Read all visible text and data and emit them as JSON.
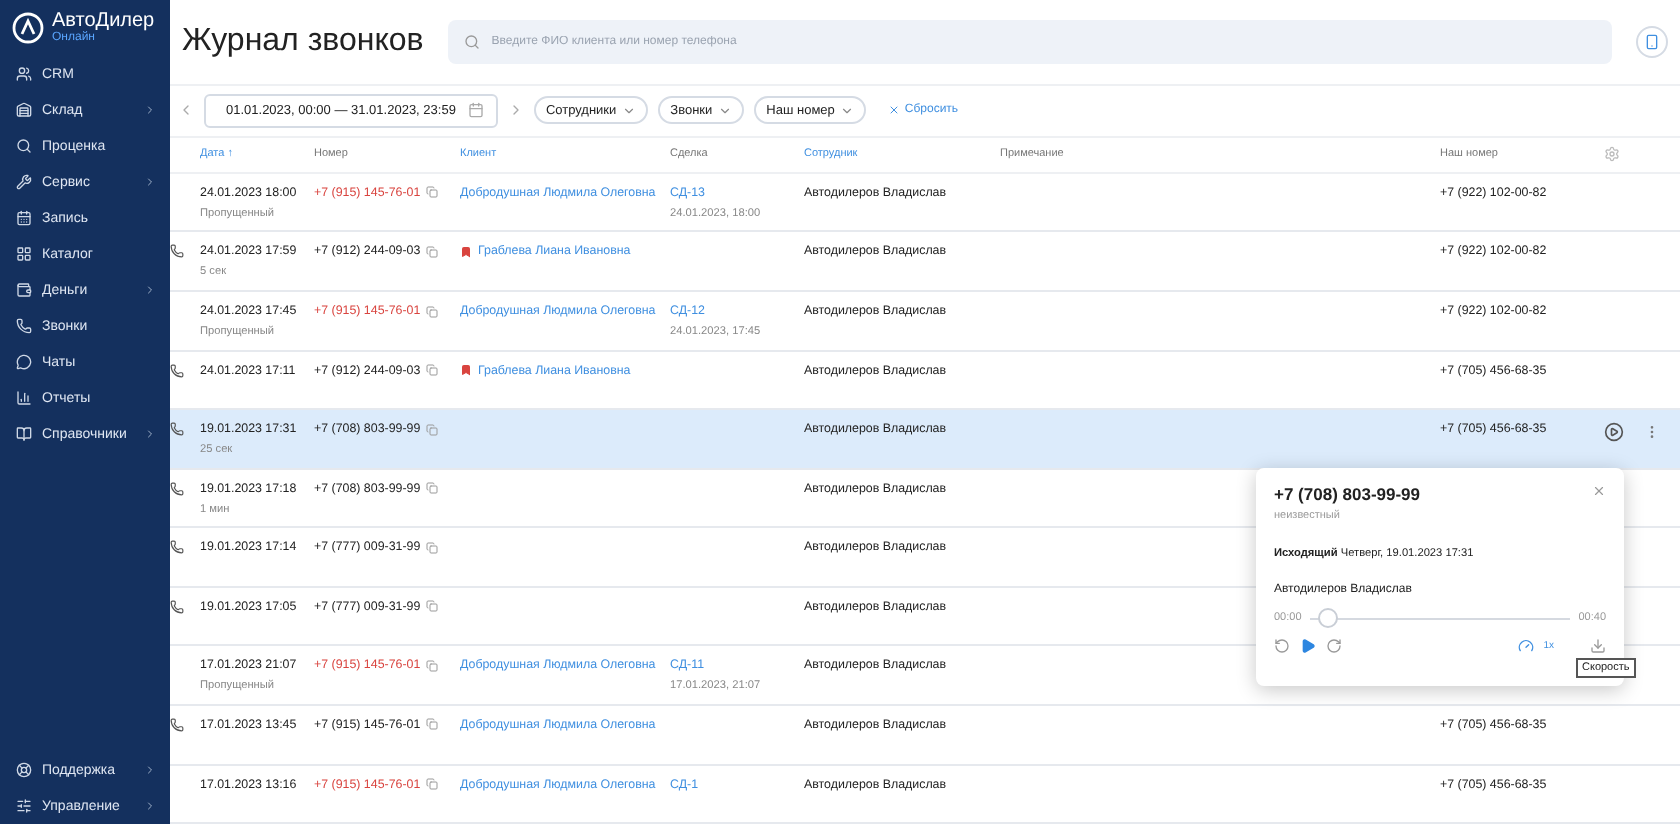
{
  "logo": {
    "name": "АвтоДилер",
    "tagline": "Онлайн"
  },
  "sidebar": {
    "items": [
      {
        "label": "CRM",
        "has_submenu": false
      },
      {
        "label": "Склад",
        "has_submenu": true
      },
      {
        "label": "Проценка",
        "has_submenu": false
      },
      {
        "label": "Сервис",
        "has_submenu": true
      },
      {
        "label": "Запись",
        "has_submenu": false
      },
      {
        "label": "Каталог",
        "has_submenu": false
      },
      {
        "label": "Деньги",
        "has_submenu": true
      },
      {
        "label": "Звонки",
        "has_submenu": false
      },
      {
        "label": "Чаты",
        "has_submenu": false
      },
      {
        "label": "Отчеты",
        "has_submenu": false
      },
      {
        "label": "Справочники",
        "has_submenu": true
      }
    ],
    "bottom_items": [
      {
        "label": "Поддержка",
        "has_submenu": true
      },
      {
        "label": "Управление",
        "has_submenu": true
      }
    ]
  },
  "title": "Журнал звонков",
  "search": {
    "placeholder": "Введите ФИО клиента или номер телефона"
  },
  "filters": {
    "date_range": "01.01.2023, 00:00 — 31.01.2023, 23:59",
    "chips": [
      "Сотрудники",
      "Звонки",
      "Наш номер"
    ],
    "reset": "Сбросить"
  },
  "table": {
    "columns": [
      "Дата ↑",
      "Номер",
      "Клиент",
      "Сделка",
      "Сотрудник",
      "Примечание",
      "Наш номер"
    ],
    "rows": [
      {
        "selected": false,
        "outgoing": false,
        "date": "24.01.2023 18:00",
        "sub": "Пропущенный",
        "phone": "+7 (915) 145-76-01",
        "missed": true,
        "client": "Добродушная Людмила Олеговна",
        "flagged": false,
        "deal": "СД-13",
        "deal_date": "24.01.2023, 18:00",
        "employee": "Автодилеров Владислав",
        "our_number": "+7 (922) 102-00-82"
      },
      {
        "selected": false,
        "outgoing": true,
        "date": "24.01.2023 17:59",
        "sub": "5 сек",
        "phone": "+7 (912) 244-09-03",
        "missed": false,
        "client": "Граблева Лиана Ивановна",
        "flagged": true,
        "employee": "Автодилеров Владислав",
        "our_number": "+7 (922) 102-00-82"
      },
      {
        "selected": false,
        "outgoing": false,
        "date": "24.01.2023 17:45",
        "sub": "Пропущенный",
        "phone": "+7 (915) 145-76-01",
        "missed": true,
        "client": "Добродушная Людмила Олеговна",
        "flagged": false,
        "deal": "СД-12",
        "deal_date": "24.01.2023, 17:45",
        "employee": "Автодилеров Владислав",
        "our_number": "+7 (922) 102-00-82"
      },
      {
        "selected": false,
        "outgoing": true,
        "date": "24.01.2023 17:11",
        "phone": "+7 (912) 244-09-03",
        "missed": false,
        "client": "Граблева Лиана Ивановна",
        "flagged": true,
        "employee": "Автодилеров Владислав",
        "our_number": "+7 (705) 456-68-35"
      },
      {
        "selected": true,
        "outgoing": true,
        "date": "19.01.2023 17:31",
        "sub": "25 сек",
        "phone": "+7 (708) 803-99-99",
        "missed": false,
        "employee": "Автодилеров Владислав",
        "our_number": "+7 (705) 456-68-35"
      },
      {
        "selected": false,
        "outgoing": true,
        "date": "19.01.2023 17:18",
        "sub": "1 мин",
        "phone": "+7 (708) 803-99-99",
        "missed": false,
        "employee": "Автодилеров Владислав"
      },
      {
        "selected": false,
        "outgoing": true,
        "date": "19.01.2023 17:14",
        "phone": "+7 (777) 009-31-99",
        "missed": false,
        "employee": "Автодилеров Владислав"
      },
      {
        "selected": false,
        "outgoing": true,
        "date": "19.01.2023 17:05",
        "phone": "+7 (777) 009-31-99",
        "missed": false,
        "employee": "Автодилеров Владислав"
      },
      {
        "selected": false,
        "outgoing": false,
        "date": "17.01.2023 21:07",
        "sub": "Пропущенный",
        "phone": "+7 (915) 145-76-01",
        "missed": true,
        "client": "Добродушная Людмила Олеговна",
        "flagged": false,
        "deal": "СД-11",
        "deal_date": "17.01.2023, 21:07",
        "employee": "Автодилеров Владислав"
      },
      {
        "selected": false,
        "outgoing": true,
        "date": "17.01.2023 13:45",
        "phone": "+7 (915) 145-76-01",
        "missed": false,
        "client": "Добродушная Людмила Олеговна",
        "flagged": false,
        "employee": "Автодилеров Владислав",
        "our_number": "+7 (705) 456-68-35"
      },
      {
        "selected": false,
        "outgoing": false,
        "date": "17.01.2023 13:16",
        "phone": "+7 (915) 145-76-01",
        "missed": true,
        "client": "Добродушная Людмила Олеговна",
        "flagged": false,
        "deal": "СД-1",
        "employee": "Автодилеров Владислав",
        "our_number": "+7 (705) 456-68-35"
      }
    ]
  },
  "popup": {
    "phone": "+7 (708) 803-99-99",
    "status": "неизвестный",
    "call_info": "**Исходящий** Четверг, 19.01.2023 17:31",
    "employee": "Автодилеров Владислав",
    "time_start": "00:00",
    "time_end": "00:40",
    "level": 0.03,
    "speed": "1x",
    "tooltip": "Скорость"
  }
}
